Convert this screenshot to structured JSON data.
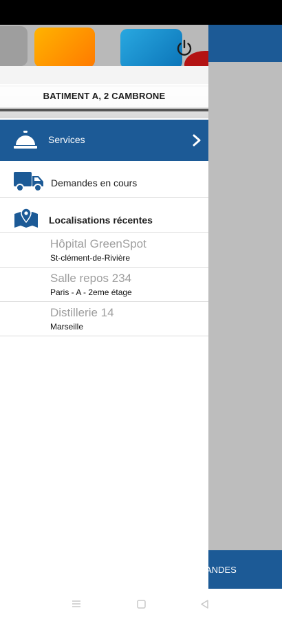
{
  "drawer": {
    "header": {
      "address": "BATIMENT A, 2 CAMBRONE",
      "power_icon": "power-icon"
    },
    "services": {
      "label": "Services",
      "icon": "concierge-bell-icon",
      "chevron": "chevron-right-icon"
    },
    "menu": {
      "demandes_label": "Demandes en cours",
      "demandes_icon": "truck-icon",
      "localisations_label": "Localisations récentes",
      "localisations_icon": "map-pin-icon"
    },
    "recent_locations": [
      {
        "name": "Hôpital GreenSpot",
        "address": "St-clément-de-Rivière"
      },
      {
        "name": "Salle repos 234",
        "address": "Paris - A - 2eme étage"
      },
      {
        "name": "Distillerie 14",
        "address": "Marseille"
      }
    ]
  },
  "background": {
    "bottom_text": "ANDES"
  },
  "colors": {
    "primary": "#1c5a96",
    "overlay": "#bdbdbd",
    "secondary_text": "#9e9e9e"
  }
}
